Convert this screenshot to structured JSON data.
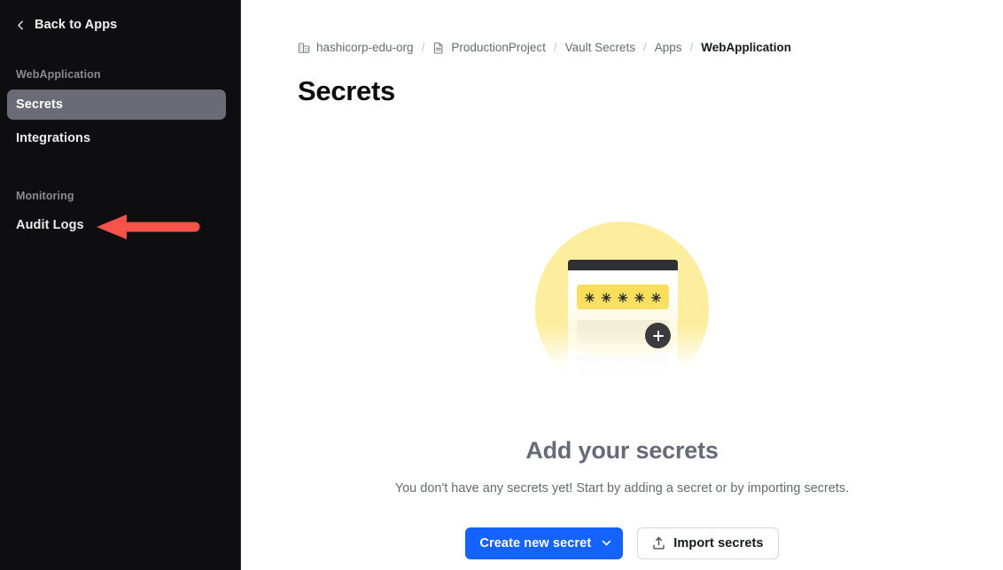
{
  "colors": {
    "sidebar_bg": "#0e0e10",
    "sidebar_active_bg": "#6b6b78",
    "accent_blue": "#1463ff",
    "annotation_red": "#f8534a",
    "illustration_yellow": "#fdee9f",
    "illustration_field_yellow": "#fade5a",
    "text_muted": "#656a76"
  },
  "sidebar": {
    "back": {
      "label": "Back to Apps",
      "icon": "chevron-left-icon"
    },
    "groups": [
      {
        "label": "WebApplication",
        "items": [
          {
            "label": "Secrets",
            "active": true
          },
          {
            "label": "Integrations",
            "active": false
          }
        ]
      },
      {
        "label": "Monitoring",
        "items": [
          {
            "label": "Audit Logs",
            "active": false
          }
        ]
      }
    ],
    "annotation": {
      "name": "red-arrow-annotation",
      "direction": "left",
      "color": "#f8534a"
    }
  },
  "breadcrumb": {
    "items": [
      {
        "label": "hashicorp-edu-org",
        "icon": "org-building-icon",
        "current": false
      },
      {
        "label": "ProductionProject",
        "icon": "document-icon",
        "current": false
      },
      {
        "label": "Vault Secrets",
        "icon": "",
        "current": false
      },
      {
        "label": "Apps",
        "icon": "",
        "current": false
      },
      {
        "label": "WebApplication",
        "icon": "",
        "current": true
      }
    ],
    "separator": "/"
  },
  "page": {
    "title": "Secrets"
  },
  "empty_state": {
    "illustration": {
      "name": "add-secrets-illustration",
      "asterisks": [
        "✳",
        "✳",
        "✳",
        "✳",
        "✳"
      ],
      "plus_icon": "plus-icon"
    },
    "title": "Add your secrets",
    "subtitle": "You don't have any secrets yet! Start by adding a secret or by importing secrets.",
    "actions": {
      "primary": {
        "label": "Create new secret",
        "icon": "chevron-down-icon"
      },
      "secondary": {
        "label": "Import secrets",
        "icon": "upload-icon"
      }
    }
  }
}
